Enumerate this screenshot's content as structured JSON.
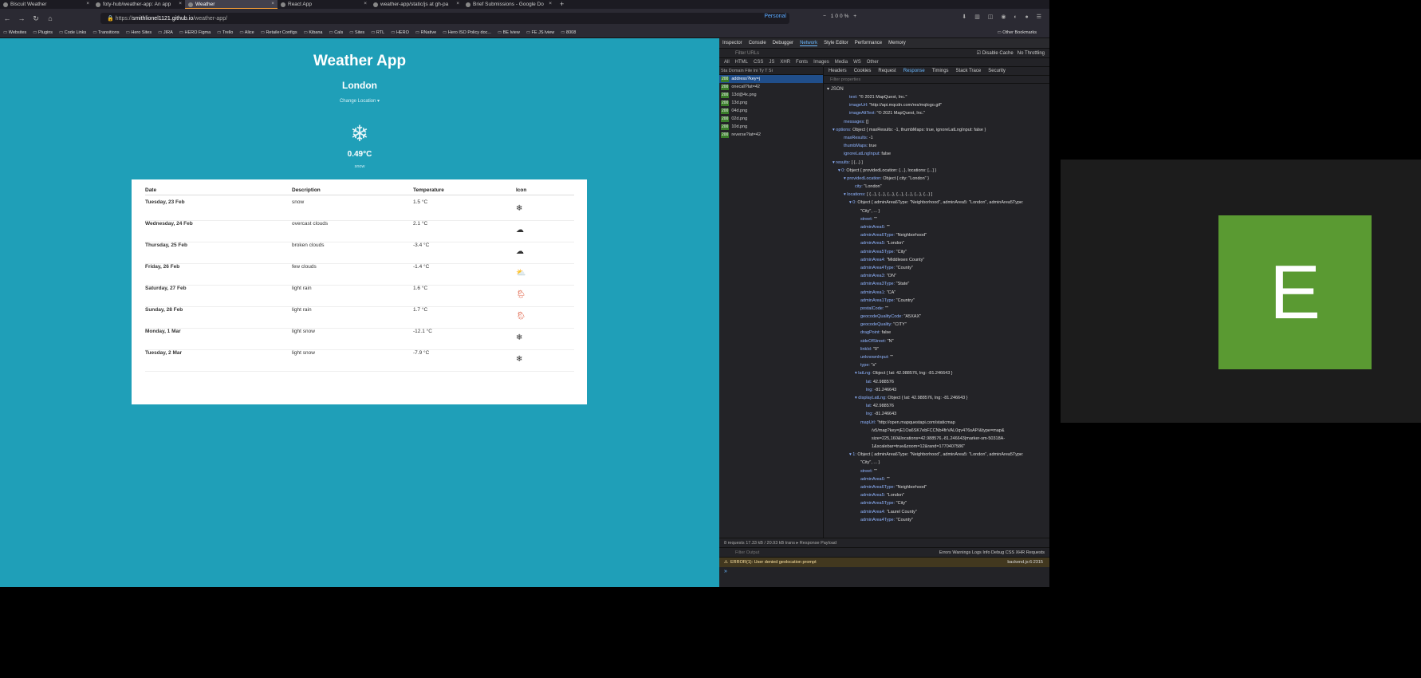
{
  "tabs": [
    {
      "title": "Biscuit Weather"
    },
    {
      "title": "foty-hub/weather-app: An app"
    },
    {
      "title": "Weather",
      "active": true
    },
    {
      "title": "React App"
    },
    {
      "title": "weather-app/static/js at gh-pa"
    },
    {
      "title": "Brief Submissions - Google Do"
    }
  ],
  "newtab": "+",
  "url": {
    "scheme": "https://",
    "host": "smithlionel1121.github.io",
    "path": "/weather-app/"
  },
  "container": "Personal",
  "zoom": "100%",
  "bookmarks": [
    "Websites",
    "Plugins",
    "Code Links",
    "Transitions",
    "Hero Sites",
    "JIRA",
    "HERO Figma",
    "Trello",
    "Alice",
    "Retailer Configs",
    "Kibana",
    "Cals",
    "Sites",
    "RTL",
    "HERO",
    "RNative",
    "Hero ISO Policy doc...",
    "BE lview",
    "FE JS lview",
    "8008"
  ],
  "other_bookmarks": "Other Bookmarks",
  "app": {
    "title": "Weather App",
    "city": "London",
    "change_location": "Change Location",
    "current_temp": "0.49°C",
    "current_desc": "snow",
    "icon_glyph": "❄",
    "headers": {
      "date": "Date",
      "description": "Description",
      "temperature": "Temperature",
      "icon": "Icon"
    },
    "rows": [
      {
        "date": "Tuesday, 23 Feb",
        "desc": "snow",
        "temp": "1.5 °C",
        "icon": "❄"
      },
      {
        "date": "Wednesday, 24 Feb",
        "desc": "overcast clouds",
        "temp": "2.1 °C",
        "icon": "☁"
      },
      {
        "date": "Thursday, 25 Feb",
        "desc": "broken clouds",
        "temp": "-3.4 °C",
        "icon": "☁"
      },
      {
        "date": "Friday, 26 Feb",
        "desc": "few clouds",
        "temp": "-1.4 °C",
        "icon": "⛅"
      },
      {
        "date": "Saturday, 27 Feb",
        "desc": "light rain",
        "temp": "1.6 °C",
        "icon": "🌦"
      },
      {
        "date": "Sunday, 28 Feb",
        "desc": "light rain",
        "temp": "1.7 °C",
        "icon": "🌦"
      },
      {
        "date": "Monday, 1 Mar",
        "desc": "light snow",
        "temp": "-12.1 °C",
        "icon": "❄"
      },
      {
        "date": "Tuesday, 2 Mar",
        "desc": "light snow",
        "temp": "-7.9 °C",
        "icon": "❄"
      }
    ]
  },
  "devtools": {
    "tabs": [
      "Inspector",
      "Console",
      "Debugger",
      "Network",
      "Style Editor",
      "Performance",
      "Memory"
    ],
    "active_tab": "Network",
    "filter_placeholder": "Filter URLs",
    "disable_cache": "Disable Cache",
    "throttling": "No Throttling",
    "types": [
      "All",
      "HTML",
      "CSS",
      "JS",
      "XHR",
      "Fonts",
      "Images",
      "Media",
      "WS",
      "Other"
    ],
    "req_columns": "Sta  Domain  File   Ini  Ty  T  Si",
    "requests": [
      {
        "status": "200",
        "file": "address?key=j",
        "sel": true
      },
      {
        "status": "200",
        "file": "onecall?lat=42"
      },
      {
        "status": "200",
        "file": "13d@4x.png"
      },
      {
        "status": "200",
        "file": "13d.png"
      },
      {
        "status": "200",
        "file": "04d.png"
      },
      {
        "status": "200",
        "file": "02d.png"
      },
      {
        "status": "200",
        "file": "10d.png"
      },
      {
        "status": "200",
        "file": "reverse?lat=42"
      }
    ],
    "resp_tabs": [
      "Headers",
      "Cookies",
      "Request",
      "Response",
      "Timings",
      "Stack Trace",
      "Security"
    ],
    "active_resp_tab": "Response",
    "filter_props": "Filter properties",
    "json_label": "JSON",
    "json_lines": [
      {
        "i": 4,
        "k": "text:",
        "v": "\"© 2021 MapQuest, Inc.\""
      },
      {
        "i": 4,
        "k": "imageUrl:",
        "v": "\"http://api.mqcdn.com/res/mqlogo.gif\""
      },
      {
        "i": 4,
        "k": "imageAltText:",
        "v": "\"© 2021 MapQuest, Inc.\""
      },
      {
        "i": 3,
        "k": "messages:",
        "v": "[]"
      },
      {
        "i": 1,
        "k": "▾ options:",
        "v": "Object { maxResults: -1, thumbMaps: true, ignoreLatLngInput: false }"
      },
      {
        "i": 3,
        "k": "maxResults:",
        "v": "-1"
      },
      {
        "i": 3,
        "k": "thumbMaps:",
        "v": "true"
      },
      {
        "i": 3,
        "k": "ignoreLatLngInput:",
        "v": "false"
      },
      {
        "i": 1,
        "k": "▾ results:",
        "v": "[ {...} ]"
      },
      {
        "i": 2,
        "k": "▾ 0:",
        "v": "Object { providedLocation: {...}, locations: [...] }"
      },
      {
        "i": 3,
        "k": "▾ providedLocation:",
        "v": "Object { city: \"London\" }"
      },
      {
        "i": 5,
        "k": "city:",
        "v": "\"London\""
      },
      {
        "i": 3,
        "k": "▾ locations:",
        "v": "[ {...}, {...}, {...}, {...}, {...}, {...}, {...} ]"
      },
      {
        "i": 4,
        "k": "▾ 0:",
        "v": "Object { adminArea6Type: \"Neighborhood\", adminArea5: \"London\", adminArea5Type:"
      },
      {
        "i": 6,
        "k": "",
        "v": "\"City\", ... }"
      },
      {
        "i": 6,
        "k": "street:",
        "v": "\"\""
      },
      {
        "i": 6,
        "k": "adminArea6:",
        "v": "\"\""
      },
      {
        "i": 6,
        "k": "adminArea6Type:",
        "v": "\"Neighborhood\""
      },
      {
        "i": 6,
        "k": "adminArea5:",
        "v": "\"London\""
      },
      {
        "i": 6,
        "k": "adminArea5Type:",
        "v": "\"City\""
      },
      {
        "i": 6,
        "k": "adminArea4:",
        "v": "\"Middlesex County\""
      },
      {
        "i": 6,
        "k": "adminArea4Type:",
        "v": "\"County\""
      },
      {
        "i": 6,
        "k": "adminArea3:",
        "v": "\"ON\""
      },
      {
        "i": 6,
        "k": "adminArea3Type:",
        "v": "\"State\""
      },
      {
        "i": 6,
        "k": "adminArea1:",
        "v": "\"CA\""
      },
      {
        "i": 6,
        "k": "adminArea1Type:",
        "v": "\"Country\""
      },
      {
        "i": 6,
        "k": "postalCode:",
        "v": "\"\""
      },
      {
        "i": 6,
        "k": "geocodeQualityCode:",
        "v": "\"A5XAX\""
      },
      {
        "i": 6,
        "k": "geocodeQuality:",
        "v": "\"CITY\""
      },
      {
        "i": 6,
        "k": "dragPoint:",
        "v": "false"
      },
      {
        "i": 6,
        "k": "sideOfStreet:",
        "v": "\"N\""
      },
      {
        "i": 6,
        "k": "linkId:",
        "v": "\"0\""
      },
      {
        "i": 6,
        "k": "unknownInput:",
        "v": "\"\""
      },
      {
        "i": 6,
        "k": "type:",
        "v": "\"s\""
      },
      {
        "i": 5,
        "k": "▾ latLng:",
        "v": "Object { lat: 42.988576, lng: -81.246643 }"
      },
      {
        "i": 7,
        "k": "lat:",
        "v": "42.988576"
      },
      {
        "i": 7,
        "k": "lng:",
        "v": "-81.246643"
      },
      {
        "i": 5,
        "k": "▾ displayLatLng:",
        "v": "Object { lat: 42.988576, lng: -81.246643 }"
      },
      {
        "i": 7,
        "k": "lat:",
        "v": "42.988576"
      },
      {
        "i": 7,
        "k": "lng:",
        "v": "-81.246643"
      },
      {
        "i": 6,
        "k": "mapUrl:",
        "v": "\"http://open.mapquestapi.com/staticmap"
      },
      {
        "i": 8,
        "k": "",
        "v": "/v5/map?key=jE1Oa6SK7ebFCCNb4firVAL0qv476sAP/&type=map&"
      },
      {
        "i": 8,
        "k": "",
        "v": "size=225,160&locations=42.988576,-81.246643|marker-sm-50318A-"
      },
      {
        "i": 8,
        "k": "",
        "v": "1&scalebar=true&zoom=12&rand=1770407586\""
      },
      {
        "i": 4,
        "k": "▾ 1:",
        "v": "Object { adminArea6Type: \"Neighborhood\", adminArea5: \"London\", adminArea5Type:"
      },
      {
        "i": 6,
        "k": "",
        "v": "\"City\", ... }"
      },
      {
        "i": 6,
        "k": "street:",
        "v": "\"\""
      },
      {
        "i": 6,
        "k": "adminArea6:",
        "v": "\"\""
      },
      {
        "i": 6,
        "k": "adminArea6Type:",
        "v": "\"Neighborhood\""
      },
      {
        "i": 6,
        "k": "adminArea5:",
        "v": "\"London\""
      },
      {
        "i": 6,
        "k": "adminArea5Type:",
        "v": "\"City\""
      },
      {
        "i": 6,
        "k": "adminArea4:",
        "v": "\"Laurel County\""
      },
      {
        "i": 6,
        "k": "adminArea4Type:",
        "v": "\"County\""
      }
    ],
    "footer": "8 requests   17.33 kB / 20.93 kB trans   ▸ Response Payload",
    "console_filter": "Filter Output",
    "console_levels": "Errors  Warnings  Logs  Info  Debug    CSS  XHR  Requests",
    "console_error": "ERROR(1): User denied geolocation prompt",
    "console_error_src": "backend.js:6:2315",
    "console_prompt": "»"
  },
  "avatar_letter": "E"
}
